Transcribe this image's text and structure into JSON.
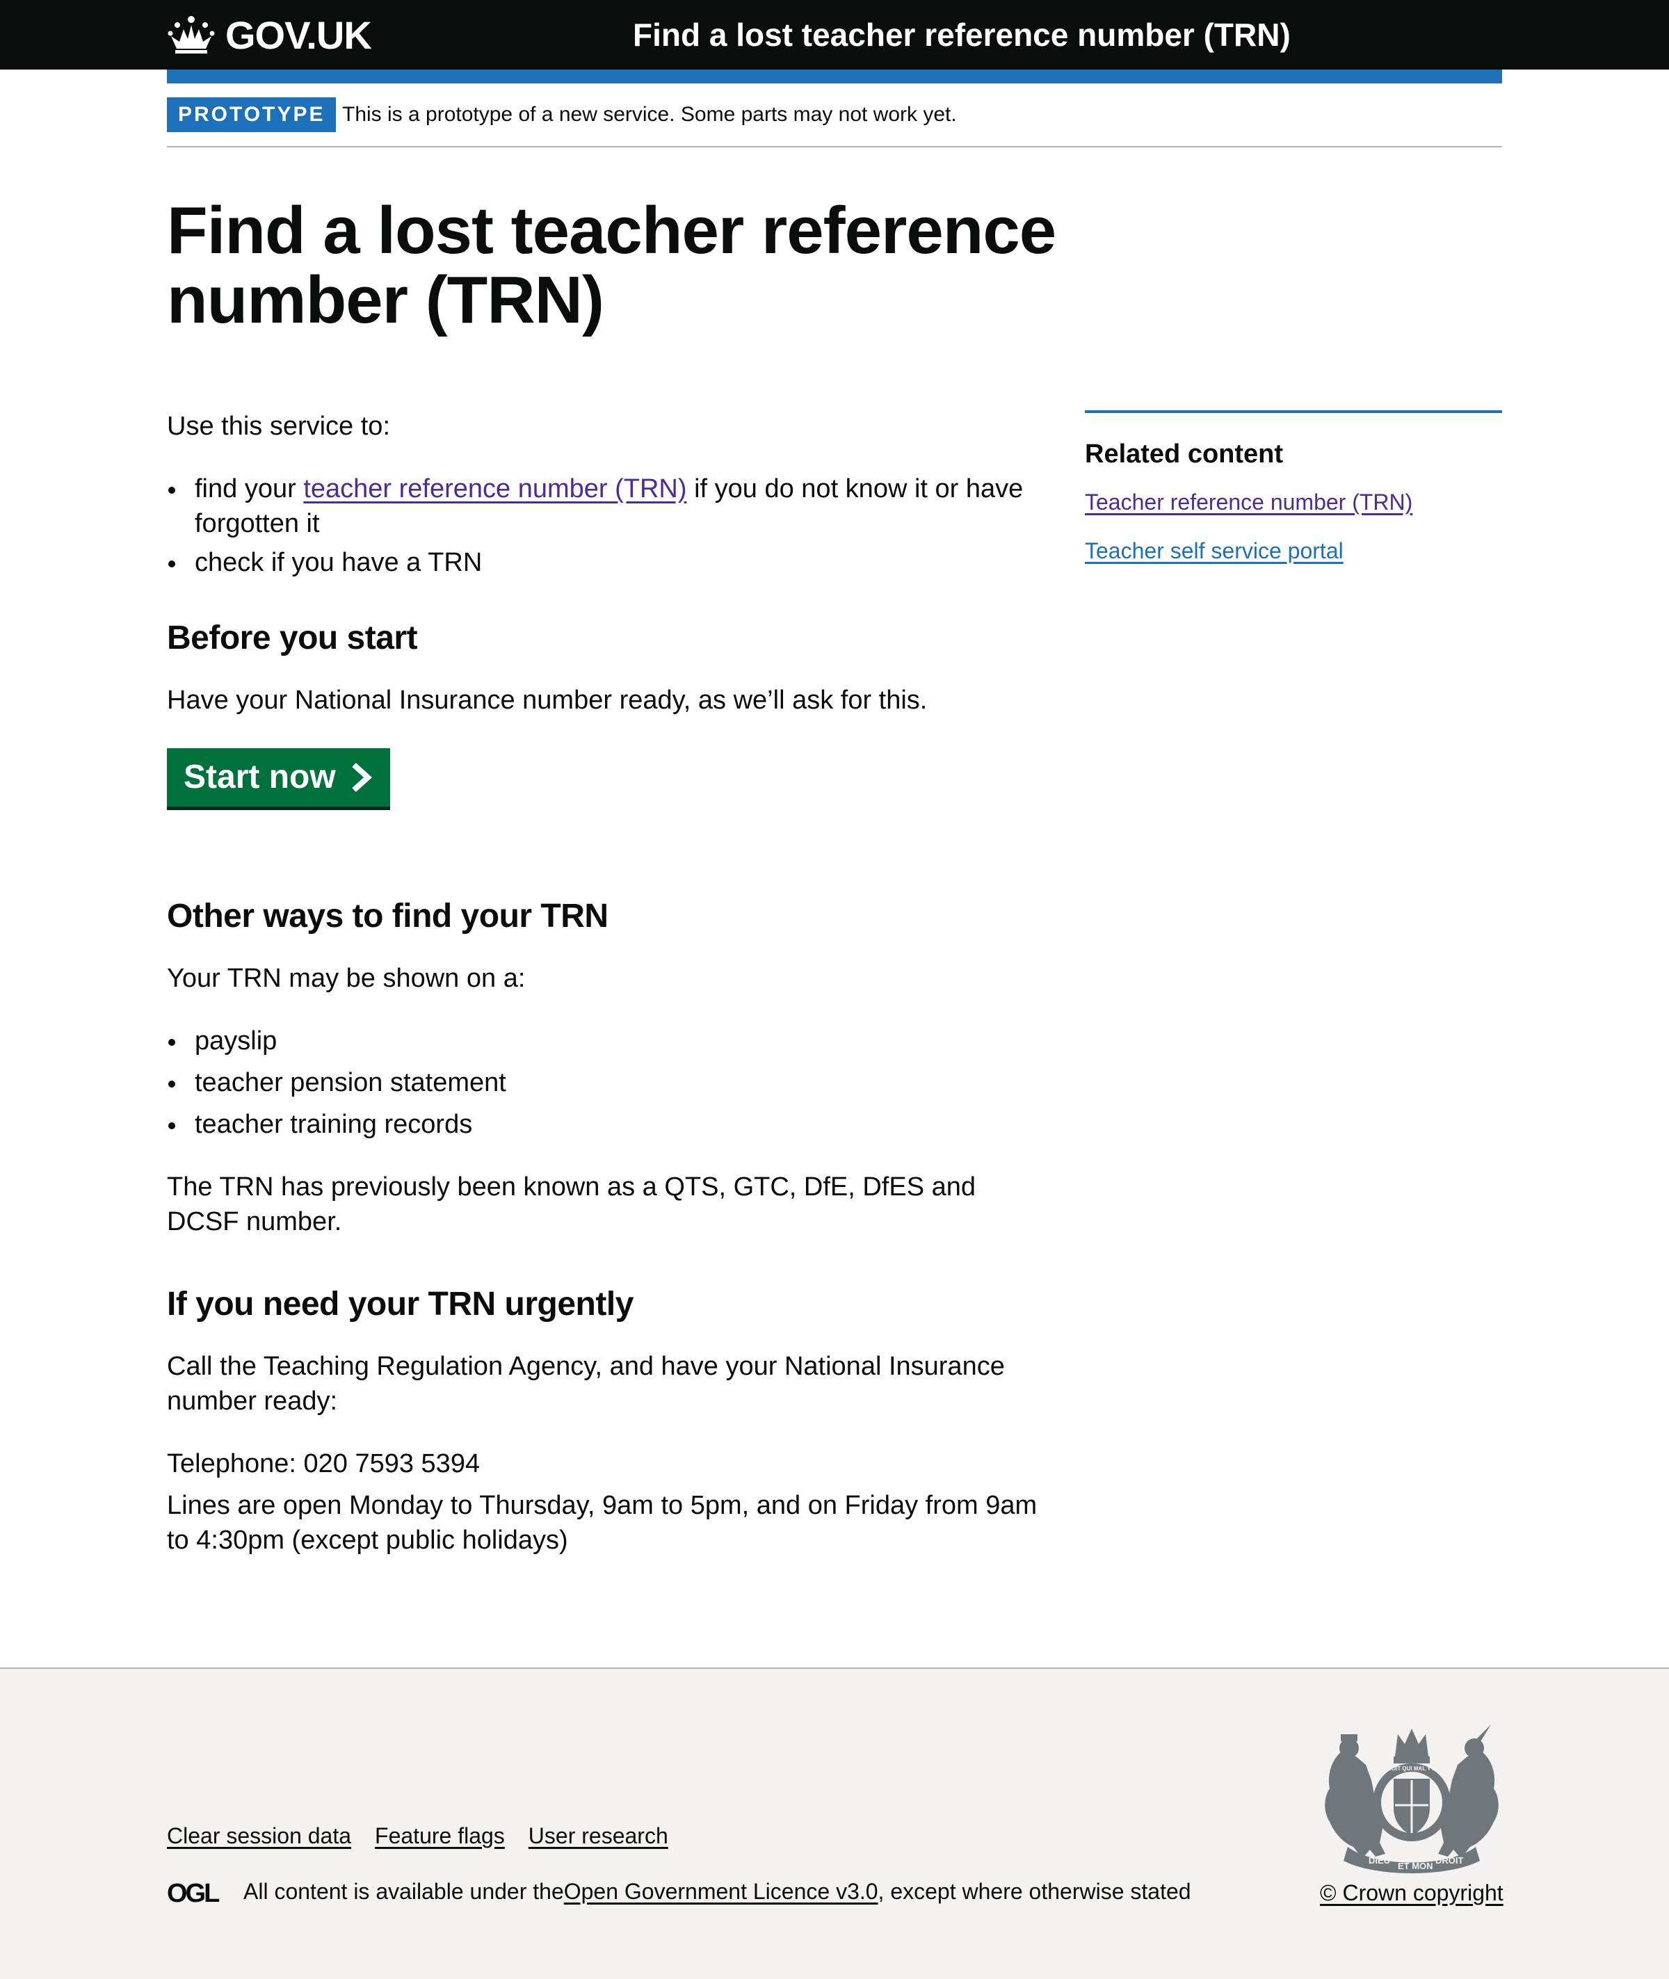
{
  "header": {
    "logo_text": "GOV.UK",
    "service_name": "Find a lost teacher reference number (TRN)"
  },
  "phase_banner": {
    "tag": "PROTOTYPE",
    "text": "This is a prototype of a new service. Some parts may not work yet."
  },
  "main": {
    "title": "Find a lost teacher reference number (TRN)",
    "intro": "Use this service to:",
    "intro_item1_prefix": "find your ",
    "intro_item1_link": "teacher reference number (TRN)",
    "intro_item1_suffix": " if you do not know it or have forgotten it",
    "intro_item2": "check if you have a TRN",
    "before_heading": "Before you start",
    "before_text": "Have your National Insurance number ready, as we’ll ask for this.",
    "start_button": "Start now",
    "other_heading": "Other ways to find your TRN",
    "other_text": "Your TRN may be shown on a:",
    "other_items": [
      "payslip",
      "teacher pension statement",
      "teacher training records"
    ],
    "previously_known": "The TRN has previously been known as a QTS, GTC, DfE, DfES and DCSF number.",
    "urgent_heading": "If you need your TRN urgently",
    "urgent_text": "Call the Teaching Regulation Agency, and have your National Insurance number ready:",
    "telephone": "Telephone: 020 7593 5394",
    "lines_open": "Lines are open Monday to Thursday, 9am to 5pm, and on Friday from 9am to 4:30pm (except public holidays)"
  },
  "related": {
    "heading": "Related content",
    "links": [
      "Teacher reference number (TRN)",
      "Teacher self service portal"
    ]
  },
  "footer": {
    "links": [
      "Clear session data",
      "Feature flags",
      "User research"
    ],
    "licence_prefix": "All content is available under the ",
    "licence_link": "Open Government Licence v3.0",
    "licence_suffix": ", except where otherwise stated",
    "copyright": "© Crown copyright",
    "ogl_logo_text": "OGL",
    "crest_text": [
      "DIEU",
      "ET MON",
      "DROIT",
      "HONI SOIT QUI MAL Y PENSE"
    ]
  },
  "colors": {
    "header_bg": "#0b0c0c",
    "brand_blue": "#1d70b8",
    "button_green": "#00703c",
    "visited_link": "#4c2c92",
    "footer_bg": "#f3f2f1"
  },
  "icons": [
    "crown-icon",
    "chevron-right-icon",
    "ogl-logo-icon",
    "royal-crest-icon"
  ]
}
